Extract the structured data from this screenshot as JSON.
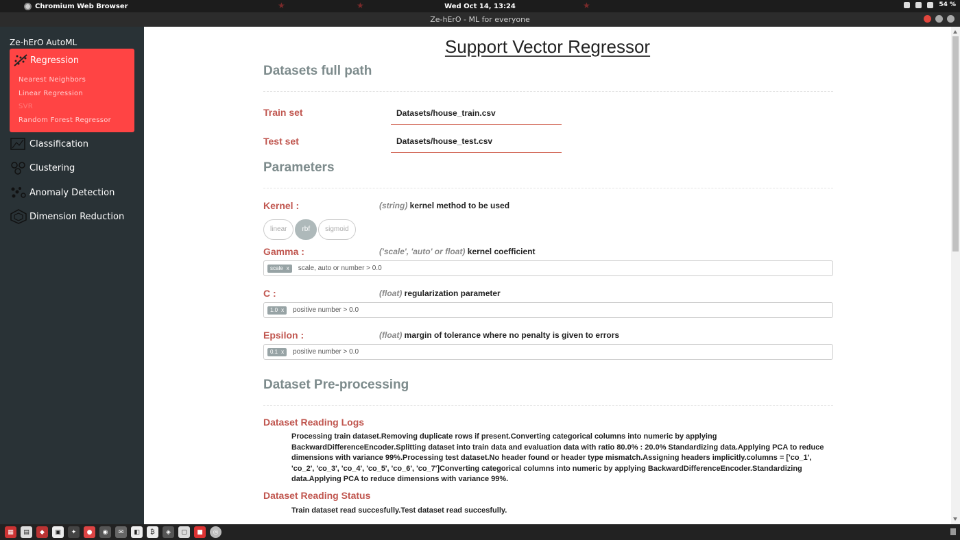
{
  "os_bar": {
    "app_name": "Chromium Web Browser",
    "clock": "Wed Oct 14, 13:24",
    "battery": "54 %"
  },
  "window": {
    "title": "Ze-hErO - ML for everyone"
  },
  "sidebar": {
    "brand": "Ze-hErO AutoML",
    "active_section": "Regression",
    "regression_items": [
      "Nearest Neighbors",
      "Linear Regression",
      "SVR",
      "Random Forest Regressor"
    ],
    "active_item": "SVR",
    "sections": [
      {
        "label": "Classification",
        "icon": "classification-icon"
      },
      {
        "label": "Clustering",
        "icon": "clustering-icon"
      },
      {
        "label": "Anomaly Detection",
        "icon": "anomaly-icon"
      },
      {
        "label": "Dimension Reduction",
        "icon": "dimension-icon"
      }
    ],
    "accent_color": "#ff4444"
  },
  "main": {
    "title": "Support Vector Regressor",
    "datasets": {
      "heading": "Datasets full path",
      "train_label": "Train set",
      "train_value": "Datasets/house_train.csv",
      "test_label": "Test set",
      "test_value": "Datasets/house_test.csv"
    },
    "parameters": {
      "heading": "Parameters",
      "kernel": {
        "label": "Kernel :",
        "type": "(string)",
        "desc": "kernel method to be used",
        "options": [
          "linear",
          "rbf",
          "sigmoid"
        ],
        "selected": "rbf"
      },
      "gamma": {
        "label": "Gamma :",
        "type": "('scale', 'auto' or float)",
        "desc": "kernel coefficient",
        "tag": "scale",
        "placeholder": "scale, auto or number > 0.0"
      },
      "c": {
        "label": "C :",
        "type": "(float)",
        "desc": "regularization parameter",
        "tag": "1.0",
        "placeholder": "positive number > 0.0"
      },
      "epsilon": {
        "label": "Epsilon :",
        "type": "(float)",
        "desc": "margin of tolerance where no penalty is given to errors",
        "tag": "0.1",
        "placeholder": "positive number > 0.0"
      }
    },
    "preprocessing": {
      "heading": "Dataset Pre-processing",
      "logs_heading": "Dataset Reading Logs",
      "logs_text": "Processing train dataset.Removing duplicate rows if present.Converting categorical columns into numeric by applying BackwardDifferenceEncoder.Splitting dataset into train data and evaluation data with ratio 80.0% : 20.0% Standardizing data.Applying PCA to reduce dimensions with variance 99%.Processing test dataset.No header found or header type mismatch.Assigning headers implicitly.columns = ['co_1', 'co_2', 'co_3', 'co_4', 'co_5', 'co_6', 'co_7']Converting categorical columns into numeric by applying BackwardDifferenceEncoder.Standardizing data.Applying PCA to reduce dimensions with variance 99%.",
      "status_heading": "Dataset Reading Status",
      "status_text": "Train dataset read succesfully.Test dataset read succesfully."
    },
    "colors": {
      "label_red": "#c0564f",
      "heading_gray": "#7d8b8c"
    }
  },
  "dock": {
    "icons": [
      "apps-icon",
      "calc-icon",
      "app-icon",
      "terminal-icon",
      "tool-icon",
      "browser-icon",
      "chat-icon",
      "mail-icon",
      "vscode-icon",
      "bitcoin-icon",
      "gnome-icon",
      "monitor-icon",
      "red-app-icon",
      "chromium-icon"
    ]
  }
}
